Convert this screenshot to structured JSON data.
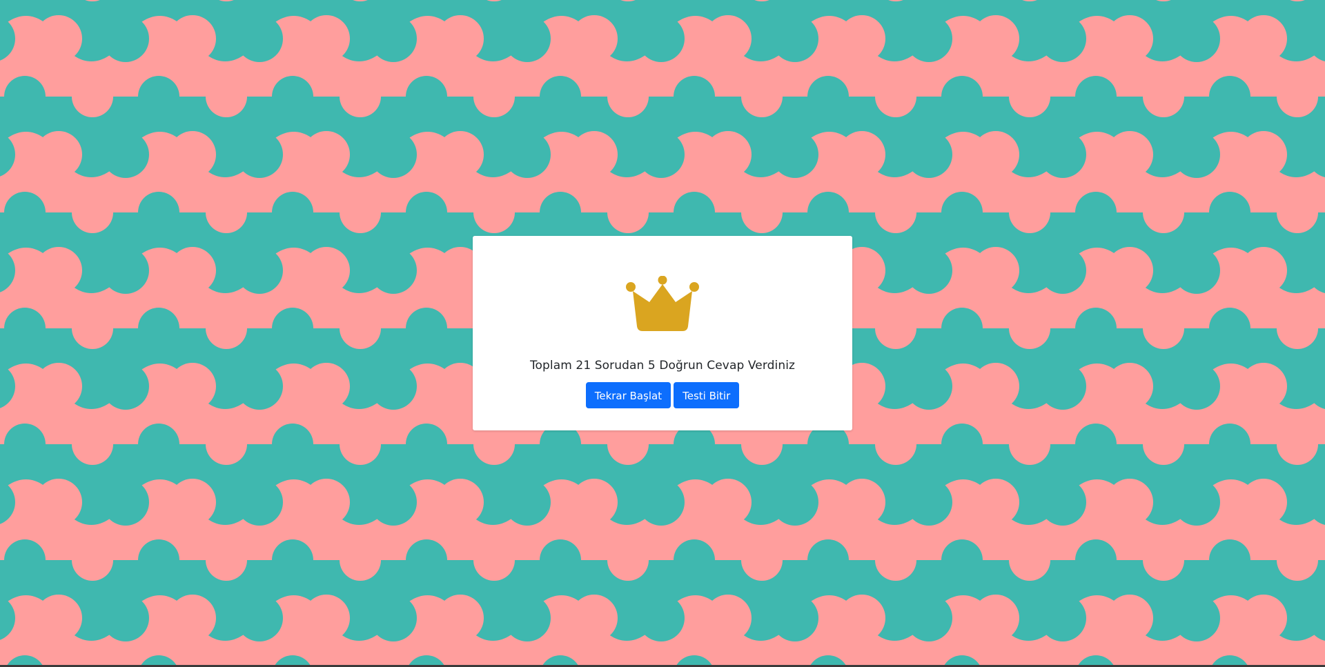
{
  "colors": {
    "background_primary": "#ff9e9d",
    "background_secondary": "#3fb8af",
    "crown": "#daa520",
    "button": "#0d6efd"
  },
  "result_card": {
    "icon": "crown-icon",
    "message": "Toplam 21 Sorudan 5 Doğrun Cevap Verdiniz",
    "restart_label": "Tekrar Başlat",
    "finish_label": "Testi Bitir"
  }
}
